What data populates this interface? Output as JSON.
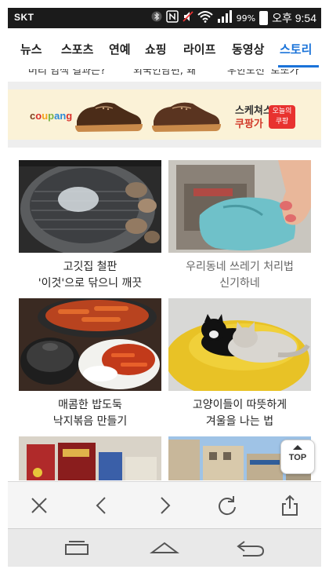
{
  "status_bar": {
    "carrier": "SKT",
    "battery": "99%",
    "time": "오후 9:54",
    "icons": [
      "bluetooth-icon",
      "nfc-icon",
      "mute-icon",
      "wifi-icon",
      "signal-icon",
      "battery-icon"
    ]
  },
  "tabs": {
    "items": [
      {
        "label": "뉴스"
      },
      {
        "label": "스포츠"
      },
      {
        "label": "연예"
      },
      {
        "label": "쇼핑"
      },
      {
        "label": "라이프"
      },
      {
        "label": "동영상"
      },
      {
        "label": "스토리"
      }
    ],
    "active_index": 6,
    "active_color": "#1a73d9"
  },
  "cut_headlines": [
    "머리 염색 결과는?",
    "외국인남편, 왜",
    "우한도전 '로또가'"
  ],
  "ad": {
    "logo": "coupang",
    "brand": "스케쳐스",
    "price": "쿠팡가",
    "coupon": [
      "오늘의",
      "쿠팡"
    ],
    "background": "#fbf2d7"
  },
  "cards": [
    {
      "lines": [
        "고깃집 철판",
        "'이것'으로 닦으니 깨끗"
      ],
      "dimmed": false
    },
    {
      "lines": [
        "우리동네 쓰레기 처리법",
        "신기하네"
      ],
      "dimmed": true
    },
    {
      "lines": [
        "매콤한 밥도둑",
        "낙지볶음 만들기"
      ],
      "dimmed": false
    },
    {
      "lines": [
        "고양이들이 따뜻하게",
        "겨울을 나는 법"
      ],
      "dimmed": false
    }
  ],
  "top_button": {
    "label": "TOP"
  },
  "toolbar": {
    "icons": [
      "close-icon",
      "back-icon",
      "forward-icon",
      "refresh-icon",
      "share-icon"
    ]
  },
  "navbar": {
    "icons": [
      "recent-apps-icon",
      "home-icon",
      "back-nav-icon"
    ]
  }
}
